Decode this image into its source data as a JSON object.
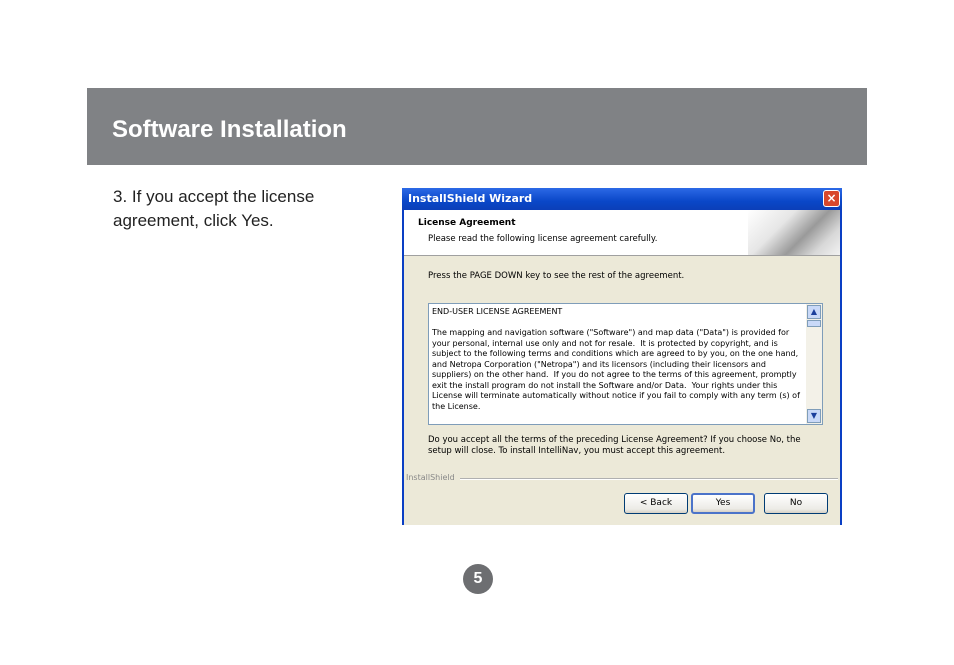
{
  "header": {
    "title": "Software Installation"
  },
  "instruction": {
    "text": "3.  If you accept the license agreement, click Yes."
  },
  "dialog": {
    "title": "InstallShield Wizard",
    "close_symbol": "×",
    "heading": "License Agreement",
    "subheading": "Please read the following license agreement carefully.",
    "pagedown_note": "Press the PAGE DOWN key to see the rest of the agreement.",
    "license_title": "END-USER LICENSE AGREEMENT",
    "license_body": "The mapping and navigation software (\"Software\") and map data (\"Data\") is provided for your personal, internal use only and not for resale.  It is protected by copyright, and is subject to the following terms and conditions which are agreed to by you, on the one hand, and Netropa Corporation (\"Netropa\") and its licensors (including their licensors and suppliers) on the other hand.  If you do not agree to the terms of this agreement, promptly exit the install program do not install the Software and/or Data.  Your rights under this License will terminate automatically without notice if you fail to comply with any term (s) of the License.",
    "scroll_up_symbol": "▲",
    "scroll_down_symbol": "▼",
    "question": "Do you accept all the terms of the preceding License Agreement?  If you choose No,  the setup will close.  To install IntelliNav, you must accept this agreement.",
    "installshield_label": "InstallShield",
    "buttons": {
      "back": "< Back",
      "yes": "Yes",
      "no": "No"
    }
  },
  "footer": {
    "page_number": "5"
  }
}
